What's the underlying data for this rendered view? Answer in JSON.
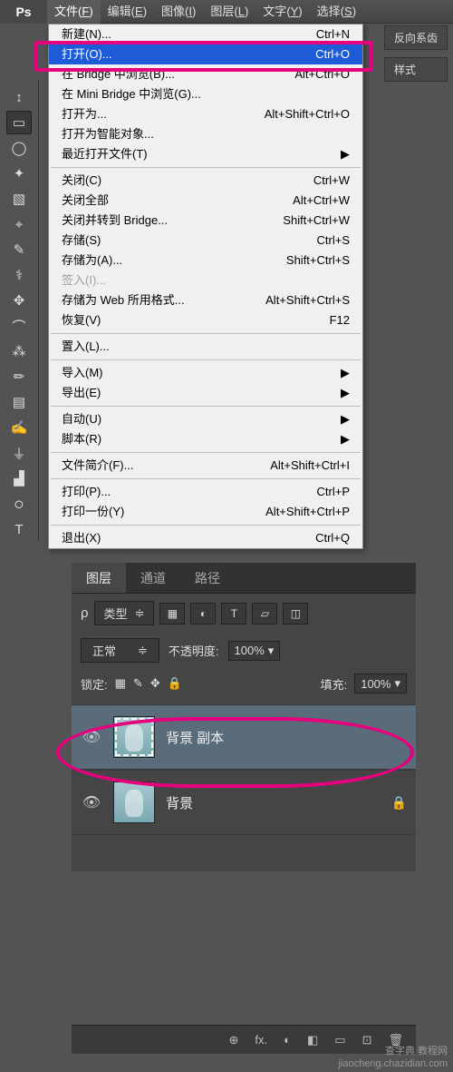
{
  "app": {
    "logo": "Ps"
  },
  "menus": [
    {
      "label": "文件",
      "key": "F",
      "active": true
    },
    {
      "label": "编辑",
      "key": "E"
    },
    {
      "label": "图像",
      "key": "I"
    },
    {
      "label": "图层",
      "key": "L"
    },
    {
      "label": "文字",
      "key": "Y"
    },
    {
      "label": "选择",
      "key": "S"
    }
  ],
  "rightButtons": [
    "反向系齿",
    "样式"
  ],
  "fileMenu": [
    {
      "label": "新建(N)...",
      "shortcut": "Ctrl+N"
    },
    {
      "label": "打开(O)...",
      "shortcut": "Ctrl+O",
      "highlighted": true
    },
    {
      "label": "在 Bridge 中浏览(B)...",
      "shortcut": "Alt+Ctrl+O"
    },
    {
      "label": "在 Mini Bridge 中浏览(G)...",
      "shortcut": ""
    },
    {
      "label": "打开为...",
      "shortcut": "Alt+Shift+Ctrl+O"
    },
    {
      "label": "打开为智能对象...",
      "shortcut": ""
    },
    {
      "label": "最近打开文件(T)",
      "shortcut": "",
      "submenu": true
    },
    {
      "sep": true
    },
    {
      "label": "关闭(C)",
      "shortcut": "Ctrl+W"
    },
    {
      "label": "关闭全部",
      "shortcut": "Alt+Ctrl+W"
    },
    {
      "label": "关闭并转到 Bridge...",
      "shortcut": "Shift+Ctrl+W"
    },
    {
      "label": "存储(S)",
      "shortcut": "Ctrl+S"
    },
    {
      "label": "存储为(A)...",
      "shortcut": "Shift+Ctrl+S"
    },
    {
      "label": "签入(I)...",
      "shortcut": "",
      "disabled": true
    },
    {
      "label": "存储为 Web 所用格式...",
      "shortcut": "Alt+Shift+Ctrl+S"
    },
    {
      "label": "恢复(V)",
      "shortcut": "F12"
    },
    {
      "sep": true
    },
    {
      "label": "置入(L)...",
      "shortcut": ""
    },
    {
      "sep": true
    },
    {
      "label": "导入(M)",
      "shortcut": "",
      "submenu": true
    },
    {
      "label": "导出(E)",
      "shortcut": "",
      "submenu": true
    },
    {
      "sep": true
    },
    {
      "label": "自动(U)",
      "shortcut": "",
      "submenu": true
    },
    {
      "label": "脚本(R)",
      "shortcut": "",
      "submenu": true
    },
    {
      "sep": true
    },
    {
      "label": "文件简介(F)...",
      "shortcut": "Alt+Shift+Ctrl+I"
    },
    {
      "sep": true
    },
    {
      "label": "打印(P)...",
      "shortcut": "Ctrl+P"
    },
    {
      "label": "打印一份(Y)",
      "shortcut": "Alt+Shift+Ctrl+P"
    },
    {
      "sep": true
    },
    {
      "label": "退出(X)",
      "shortcut": "Ctrl+Q"
    }
  ],
  "tools": [
    "↕",
    "▭",
    "◯",
    "✦",
    "▧",
    "⌖",
    "✎",
    "⚕",
    "✥",
    "⌒",
    "⁂",
    "✏",
    "▤",
    "✍",
    "⏚",
    "▟",
    "੦",
    "T"
  ],
  "panel": {
    "tabs": [
      {
        "label": "图层",
        "active": true
      },
      {
        "label": "通道"
      },
      {
        "label": "路径"
      }
    ],
    "filterLabel": "类型",
    "blendMode": "正常",
    "opacityLabel": "不透明度:",
    "opacityValue": "100%",
    "lockLabel": "锁定:",
    "fillLabel": "填充:",
    "fillValue": "100%",
    "layers": [
      {
        "name": "背景 副本",
        "selected": true
      },
      {
        "name": "背景",
        "locked": true
      }
    ],
    "footerIcons": [
      "⊕",
      "fx.",
      "◐",
      "◧",
      "▭",
      "⊡",
      "🗑"
    ]
  },
  "watermark": {
    "line1": "查字典 教程网",
    "line2": "jiaocheng.chazidian.com"
  }
}
